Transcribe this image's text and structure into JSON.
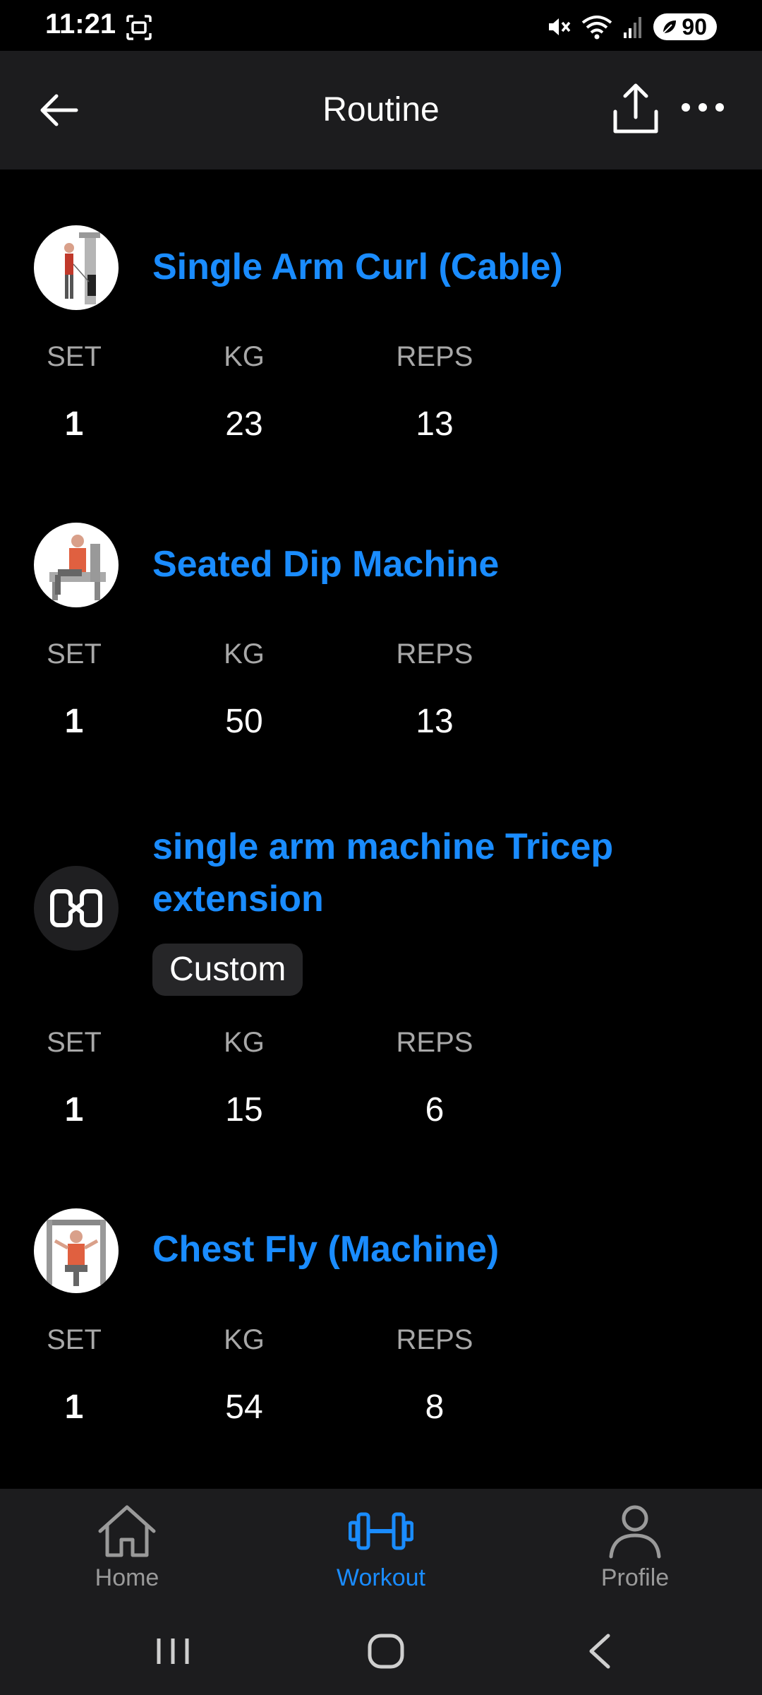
{
  "status_bar": {
    "time": "11:21",
    "battery": "90"
  },
  "header": {
    "title": "Routine"
  },
  "columns": {
    "set": "SET",
    "kg": "KG",
    "reps": "REPS"
  },
  "exercises": [
    {
      "name": "Single Arm Curl (Cable)",
      "set": "1",
      "kg": "23",
      "reps": "13",
      "thumbnail": "cable-curl-illustration"
    },
    {
      "name": "Seated Dip Machine",
      "set": "1",
      "kg": "50",
      "reps": "13",
      "thumbnail": "seated-dip-illustration"
    },
    {
      "name_line1": "single arm machine Tricep",
      "name_line2": "extension",
      "tag": "Custom",
      "set": "1",
      "kg": "15",
      "reps": "6",
      "thumbnail": "custom-exercise-icon"
    },
    {
      "name": "Chest Fly (Machine)",
      "set": "1",
      "kg": "54",
      "reps": "8",
      "thumbnail": "chest-fly-illustration"
    }
  ],
  "bottom_nav": {
    "items": [
      {
        "label": "Home",
        "icon": "home-icon",
        "active": false
      },
      {
        "label": "Workout",
        "icon": "dumbbell-icon",
        "active": true
      },
      {
        "label": "Profile",
        "icon": "profile-icon",
        "active": false
      }
    ]
  },
  "colors": {
    "accent": "#1a8cff",
    "header_bg": "#1c1c1e",
    "muted": "#a8a8a8",
    "inactive_nav": "#9a9a9a"
  }
}
